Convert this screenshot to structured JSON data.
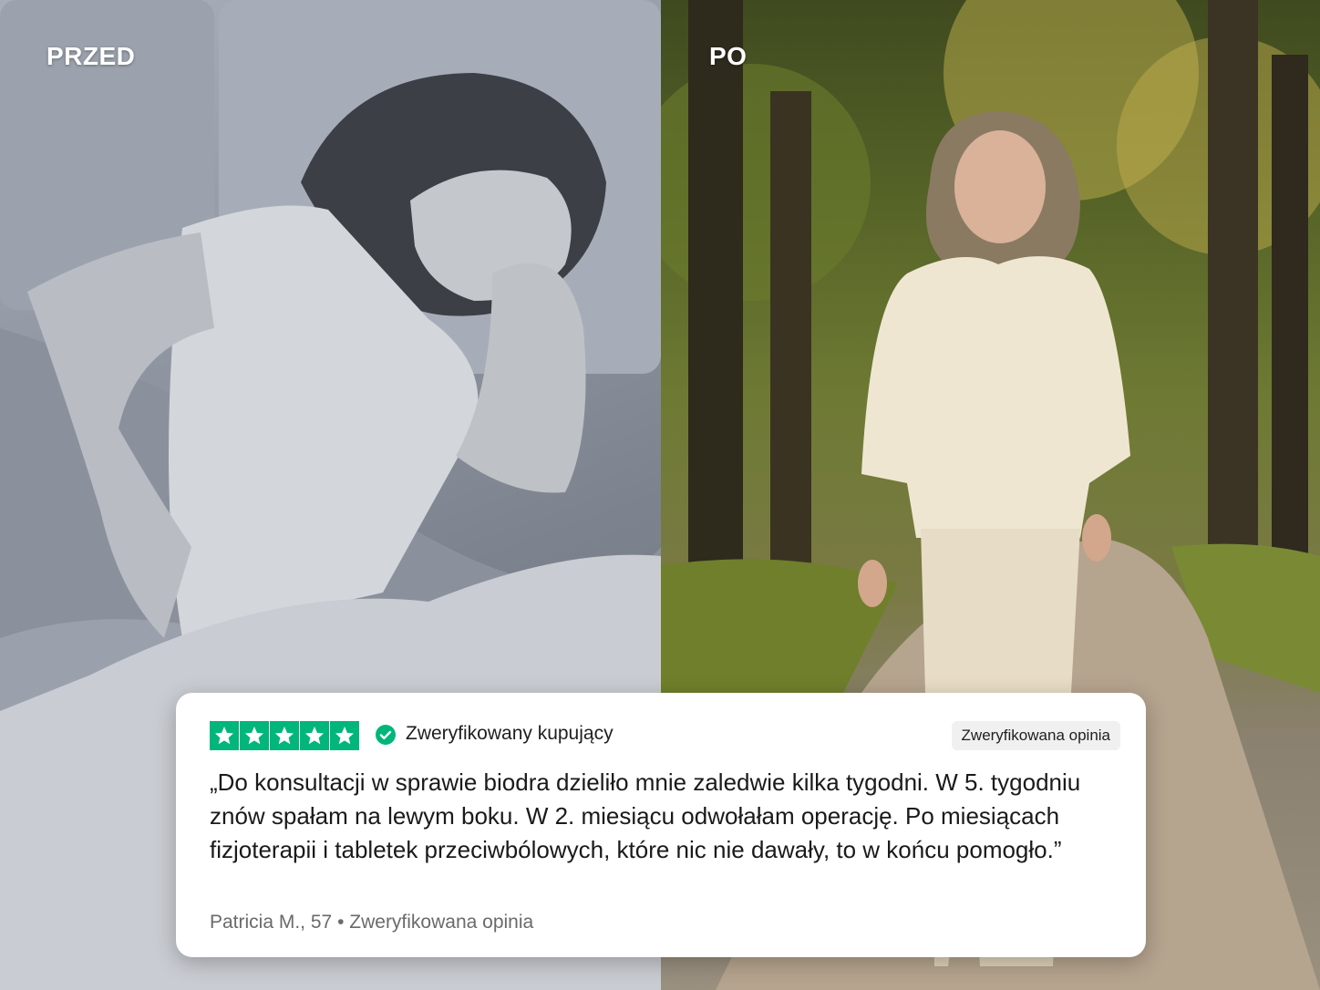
{
  "labels": {
    "before": "PRZED",
    "after": "PO"
  },
  "review": {
    "stars": 5,
    "verified_buyer": "Zweryfikowany kupujący",
    "badge": "Zweryfikowana opinia",
    "quote": "„Do konsultacji w sprawie biodra dzieliło mnie zaledwie kilka tygodni. W 5. tygodniu znów spałam na lewym boku. W 2. miesiącu odwołałam operację. Po miesiącach fizjoterapii i tabletek przeciwbólowych, które nic nie dawały, to w końcu pomogło.”",
    "author": "Patricia M., 57",
    "author_separator": "•",
    "author_note": "Zweryfikowana opinia"
  },
  "colors": {
    "accent": "#00b67a",
    "card": "#ffffff"
  },
  "icons": {
    "star": "star-icon",
    "check": "check-circle-icon"
  }
}
